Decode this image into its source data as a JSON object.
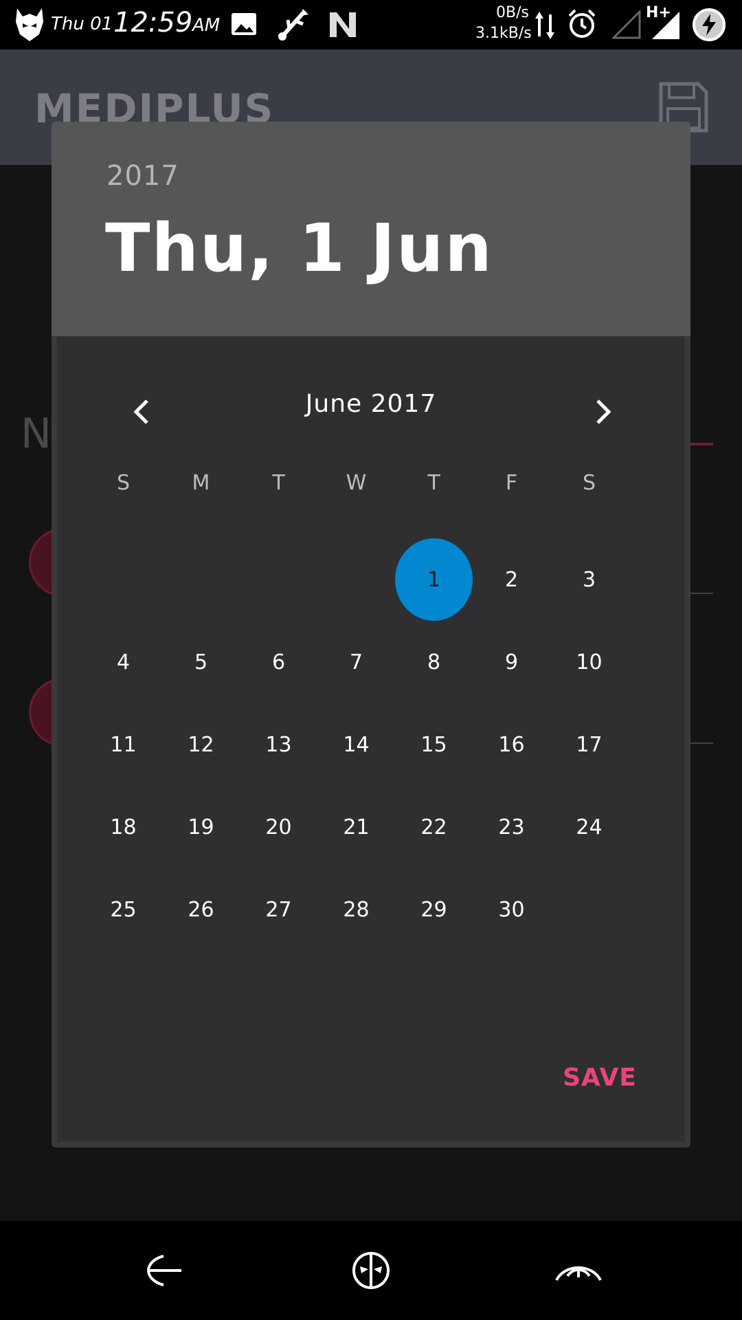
{
  "status_bar": {
    "day": "Thu 01",
    "time": "12:59",
    "ampm": "AM",
    "net_up": "0B/s",
    "net_down": "3.1kB/s",
    "network_type": "H+",
    "icons": [
      "mask-logo-icon",
      "image-icon",
      "usb-icon",
      "n-logo-icon",
      "data-arrows-icon",
      "alarm-icon",
      "signal-empty-icon",
      "signal-full-icon",
      "battery-charging-icon"
    ]
  },
  "app": {
    "title": "MEDIPLUS",
    "partial_heading": "N"
  },
  "dialog": {
    "year": "2017",
    "selected_date": "Thu, 1 Jun",
    "month_label": "June 2017",
    "weekdays": [
      "S",
      "M",
      "T",
      "W",
      "T",
      "F",
      "S"
    ],
    "leading_blanks": 4,
    "days_in_month": 30,
    "selected_day": 1,
    "selected_color": "#0288d1",
    "save_label": "SAVE",
    "save_color": "#e8457a"
  },
  "navigation_bar": {
    "icons": [
      "back-icon",
      "home-icon",
      "recents-icon"
    ]
  }
}
